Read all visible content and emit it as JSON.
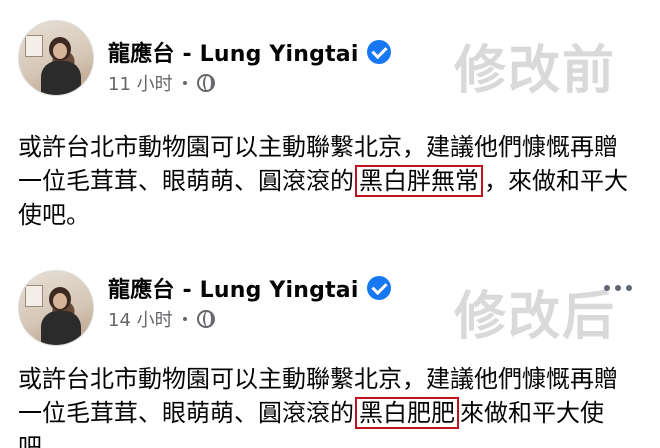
{
  "watermark_before": "修改前",
  "watermark_after": "修改后",
  "post_before": {
    "author": "龍應台 - Lung Yingtai",
    "time": "11 小时",
    "text_prefix": "或許台北市動物園可以主動聯繫北京，建議他們慷慨再贈一位毛茸茸、眼萌萌、圓滾滾的",
    "highlight": "黑白胖無常",
    "text_suffix": "，來做和平大使吧。"
  },
  "post_after": {
    "author": "龍應台 - Lung Yingtai",
    "time": "14 小时",
    "text_prefix": "或許台北市動物園可以主動聯繫北京，建議他們慷慨再贈一位毛茸茸、眼萌萌、圓滾滾的",
    "highlight": "黑白肥肥",
    "text_suffix": "來做和平大使吧。"
  },
  "colors": {
    "verified": "#1877f2",
    "highlight_border": "#c1121f",
    "watermark": "#d9d9d9",
    "meta_text": "#65676b"
  },
  "icons": [
    "verified-badge-icon",
    "globe-icon",
    "more-options-icon"
  ]
}
